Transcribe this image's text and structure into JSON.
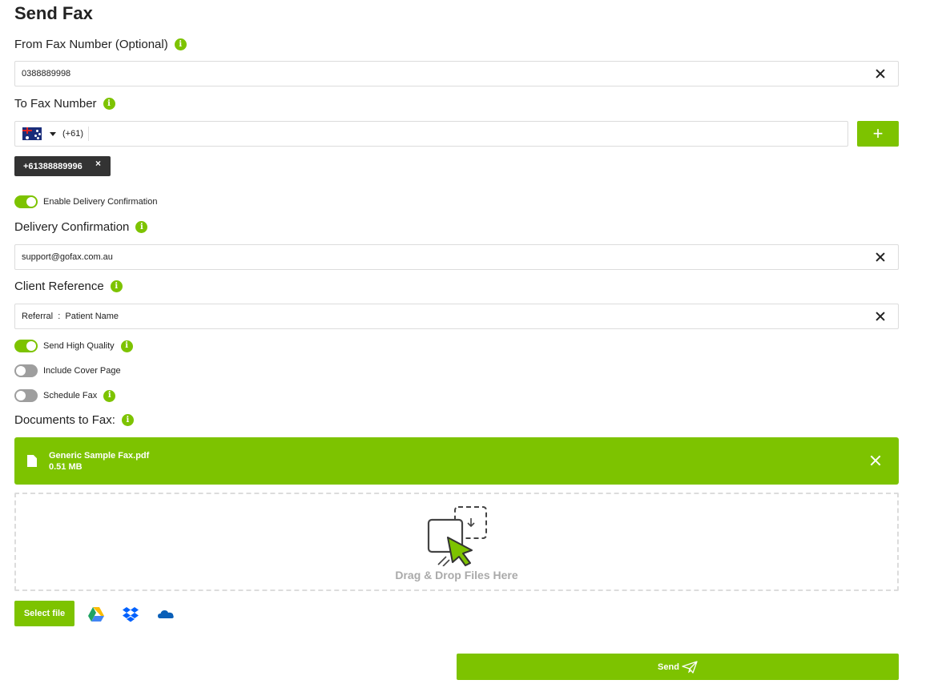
{
  "page": {
    "title": "Send Fax"
  },
  "from_fax": {
    "label": "From Fax Number (Optional)",
    "value": "0388889998"
  },
  "to_fax": {
    "label": "To Fax Number",
    "dial_code": "(+61)",
    "country": "Australia",
    "value": "",
    "add_label": "+",
    "recipients": [
      "+61388889996"
    ],
    "chip_remove": "×"
  },
  "delivery_toggle": {
    "label": "Enable Delivery Confirmation",
    "on": true
  },
  "delivery_confirmation": {
    "label": "Delivery Confirmation",
    "value": "support@gofax.com.au"
  },
  "client_reference": {
    "label": "Client Reference",
    "value": "Referral  :  Patient Name"
  },
  "options": {
    "high_quality": {
      "label": "Send High Quality",
      "on": true
    },
    "cover_page": {
      "label": "Include Cover Page",
      "on": false
    },
    "schedule": {
      "label": "Schedule Fax",
      "on": false
    }
  },
  "documents": {
    "label": "Documents to Fax:",
    "files": [
      {
        "name": "Generic Sample Fax.pdf",
        "size": "0.51 MB"
      }
    ],
    "drop_text": "Drag & Drop Files Here",
    "select_label": "Select file",
    "sources": [
      "google-drive",
      "dropbox",
      "onedrive"
    ]
  },
  "send": {
    "label": "Send"
  },
  "colors": {
    "accent": "#7dc300",
    "chip": "#333333",
    "border": "#dcdcdc"
  },
  "info_glyph": "i"
}
